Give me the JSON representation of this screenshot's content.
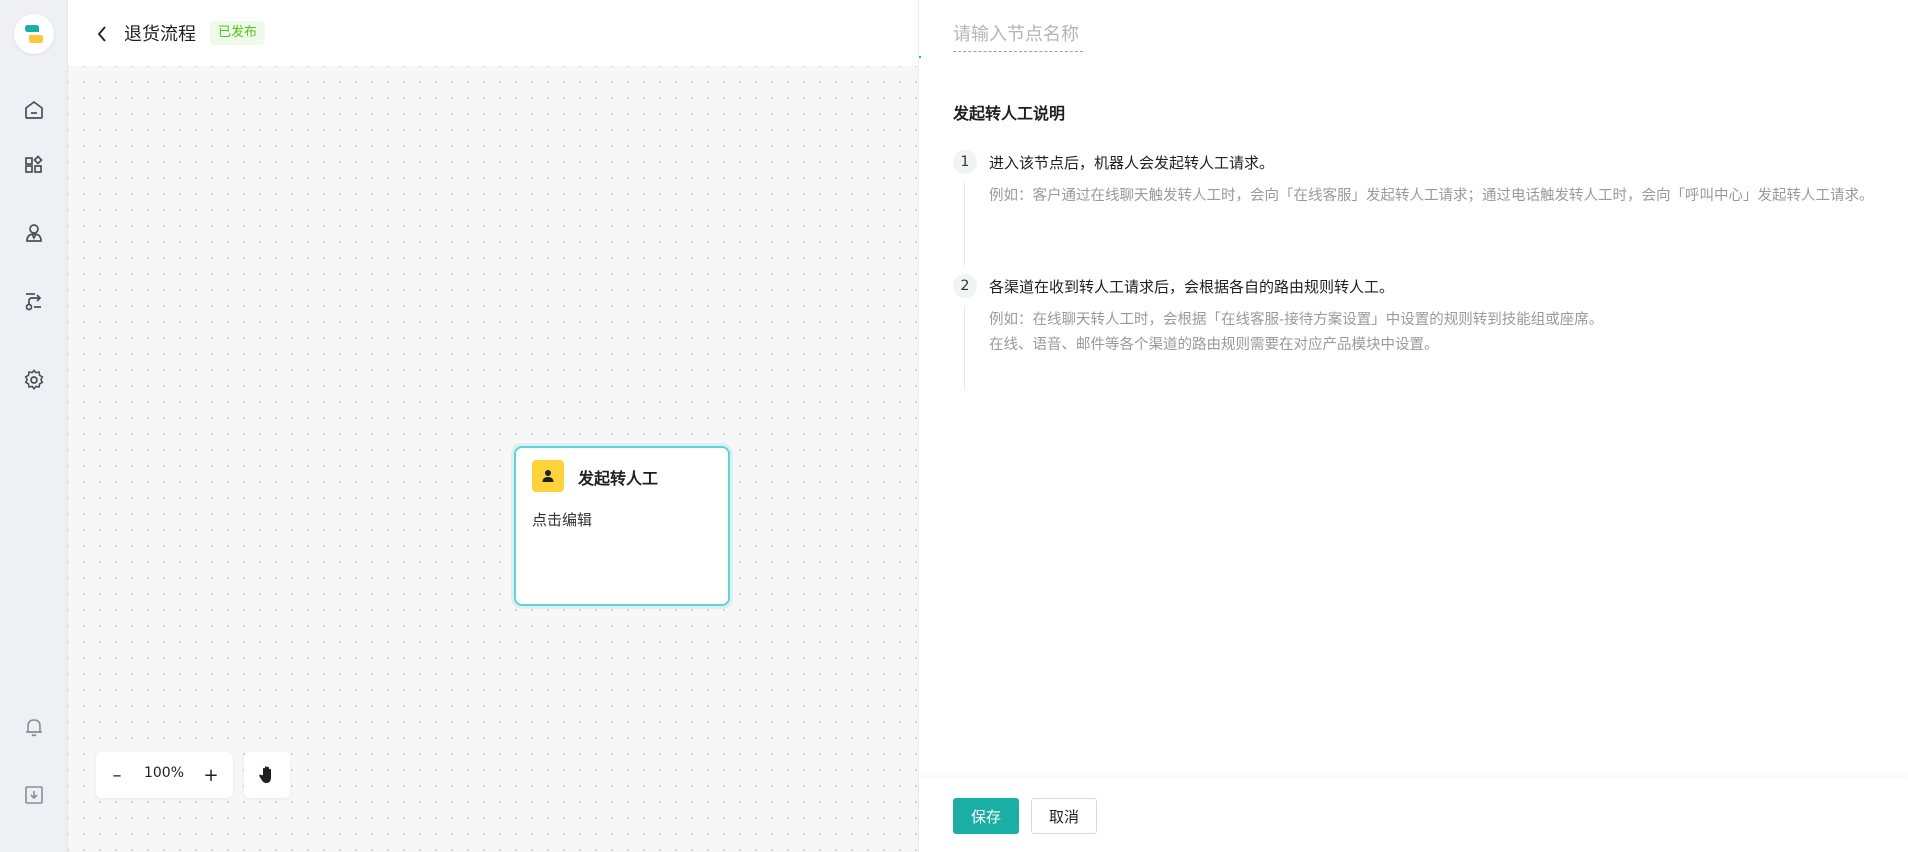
{
  "header": {
    "back_icon": "chevron-left-icon",
    "title": "退货流程",
    "status": "已发布",
    "close_icon": "close-icon"
  },
  "sidebar": {
    "logo": "app-logo",
    "items": [
      {
        "icon": "home-icon"
      },
      {
        "icon": "apps-icon"
      },
      {
        "icon": "agent-icon"
      },
      {
        "icon": "flow-icon"
      },
      {
        "icon": "settings-icon"
      }
    ],
    "bottom_items": [
      {
        "icon": "bell-icon"
      },
      {
        "icon": "download-icon"
      }
    ]
  },
  "canvas": {
    "node": {
      "icon": "person-icon",
      "title": "发起转人工",
      "subtitle": "点击编辑"
    },
    "zoom": {
      "out_label": "–",
      "level": "100%",
      "in_label": "+"
    },
    "hand_tool_icon": "hand-icon"
  },
  "panel": {
    "name_placeholder": "请输入节点名称",
    "section_title": "发起转人工说明",
    "steps": [
      {
        "num": "1",
        "text": "进入该节点后，机器人会发起转人工请求。",
        "example": "例如：客户通过在线聊天触发转人工时，会向「在线客服」发起转人工请求；通过电话触发转人工时，会向「呼叫中心」发起转人工请求。"
      },
      {
        "num": "2",
        "text": "各渠道在收到转人工请求后，会根据各自的路由规则转人工。",
        "example_lines": [
          "例如：在线聊天转人工时，会根据「在线客服-接待方案设置」中设置的规则转到技能组或座席。",
          "在线、语音、邮件等各个渠道的路由规则需要在对应产品模块中设置。"
        ]
      }
    ],
    "save_label": "保存",
    "cancel_label": "取消"
  },
  "colors": {
    "primary": "#1aaea5",
    "node_border": "#5fd4d4",
    "node_icon_bg": "#ffd43b",
    "status_green": "#52c41a"
  }
}
